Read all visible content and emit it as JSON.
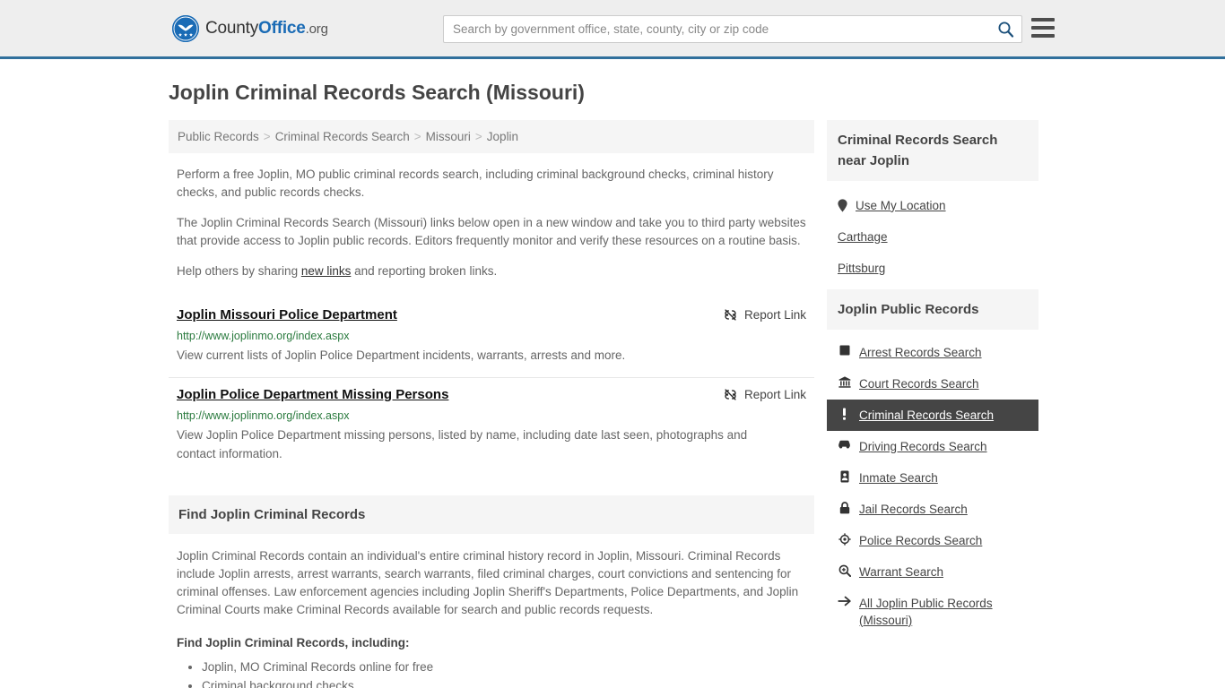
{
  "header": {
    "logo": {
      "text_county": "County",
      "text_office": "Office",
      "text_tld": ".org",
      "icon": "eagle-seal-icon"
    },
    "search": {
      "placeholder": "Search by government office, state, county, city or zip code",
      "value": "",
      "icon": "search-icon"
    },
    "menu_icon": "hamburger-menu-icon",
    "accent_color": "#31709c"
  },
  "page": {
    "title": "Joplin Criminal Records Search (Missouri)"
  },
  "breadcrumb": {
    "separator": ">",
    "items": [
      {
        "label": "Public Records"
      },
      {
        "label": "Criminal Records Search"
      },
      {
        "label": "Missouri"
      },
      {
        "label": "Joplin"
      }
    ]
  },
  "intro": {
    "p1": "Perform a free Joplin, MO public criminal records search, including criminal background checks, criminal history checks, and public records checks.",
    "p2": "The Joplin Criminal Records Search (Missouri) links below open in a new window and take you to third party websites that provide access to Joplin public records. Editors frequently monitor and verify these resources on a routine basis.",
    "p3_before": "Help others by sharing ",
    "p3_link": "new links",
    "p3_after": " and reporting broken links."
  },
  "results": {
    "report_label": "Report Link",
    "report_icon": "chain-broken-icon",
    "items": [
      {
        "title": "Joplin Missouri Police Department",
        "url": "http://www.joplinmo.org/index.aspx",
        "description": "View current lists of Joplin Police Department incidents, warrants, arrests and more."
      },
      {
        "title": "Joplin Police Department Missing Persons",
        "url": "http://www.joplinmo.org/index.aspx",
        "description": "View Joplin Police Department missing persons, listed by name, including date last seen, photographs and contact information."
      }
    ]
  },
  "find_section": {
    "heading": "Find Joplin Criminal Records",
    "paragraph": "Joplin Criminal Records contain an individual's entire criminal history record in Joplin, Missouri. Criminal Records include Joplin arrests, arrest warrants, search warrants, filed criminal charges, court convictions and sentencing for criminal offenses. Law enforcement agencies including Joplin Sheriff's Departments, Police Departments, and Joplin Criminal Courts make Criminal Records available for search and public records requests.",
    "subheading": "Find Joplin Criminal Records, including:",
    "bullets": [
      "Joplin, MO Criminal Records online for free",
      "Criminal background checks"
    ]
  },
  "sidebar": {
    "near": {
      "heading": "Criminal Records Search near Joplin",
      "items": [
        {
          "label": "Use My Location",
          "icon": "map-pin-icon"
        },
        {
          "label": "Carthage",
          "icon": ""
        },
        {
          "label": "Pittsburg",
          "icon": ""
        }
      ]
    },
    "public_records": {
      "heading": "Joplin Public Records",
      "items": [
        {
          "label": "Arrest Records Search",
          "icon": "square-icon",
          "active": false
        },
        {
          "label": "Court Records Search",
          "icon": "courthouse-icon",
          "active": false
        },
        {
          "label": "Criminal Records Search",
          "icon": "exclamation-icon",
          "active": true
        },
        {
          "label": "Driving Records Search",
          "icon": "car-icon",
          "active": false
        },
        {
          "label": "Inmate Search",
          "icon": "id-badge-icon",
          "active": false
        },
        {
          "label": "Jail Records Search",
          "icon": "lock-icon",
          "active": false
        },
        {
          "label": "Police Records Search",
          "icon": "police-badge-icon",
          "active": false
        },
        {
          "label": "Warrant Search",
          "icon": "magnifier-plus-icon",
          "active": false
        },
        {
          "label": "All Joplin Public Records (Missouri)",
          "icon": "arrow-right-icon",
          "active": false
        }
      ],
      "active_bg": "#454545"
    }
  }
}
